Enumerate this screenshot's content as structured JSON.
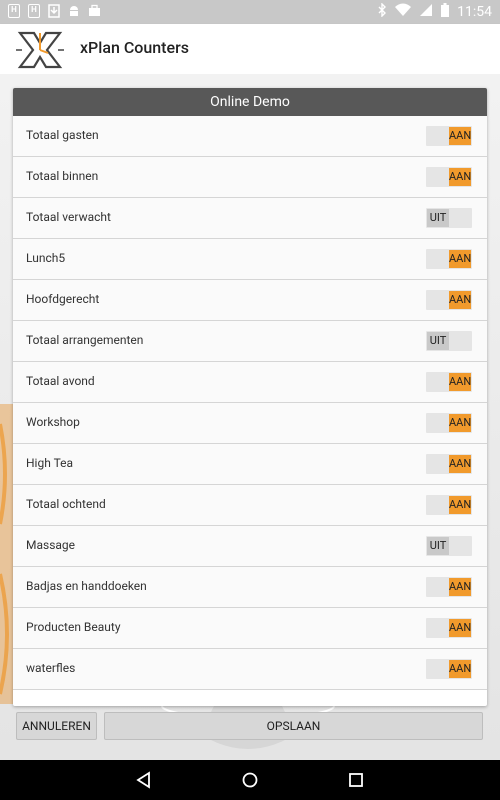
{
  "status_bar": {
    "left_icons": [
      "sdcard-icon",
      "sdcard-icon",
      "download-icon",
      "android-icon",
      "briefcase-icon"
    ],
    "right_icons": [
      "bluetooth-icon",
      "wifi-icon",
      "signal-icon",
      "battery-icon"
    ],
    "time": "11:54"
  },
  "app_bar": {
    "title": "xPlan Counters",
    "logo_icon": "xplan-logo-icon"
  },
  "dialog": {
    "title": "Online Demo",
    "rows": [
      {
        "label": "Totaal gasten",
        "state": "AAN"
      },
      {
        "label": "Totaal binnen",
        "state": "AAN"
      },
      {
        "label": "Totaal verwacht",
        "state": "UIT"
      },
      {
        "label": "Lunch5",
        "state": "AAN"
      },
      {
        "label": "Hoofdgerecht",
        "state": "AAN"
      },
      {
        "label": "Totaal arrangementen",
        "state": "UIT"
      },
      {
        "label": "Totaal avond",
        "state": "AAN"
      },
      {
        "label": "Workshop",
        "state": "AAN"
      },
      {
        "label": "High Tea",
        "state": "AAN"
      },
      {
        "label": "Totaal ochtend",
        "state": "AAN"
      },
      {
        "label": "Massage",
        "state": "UIT"
      },
      {
        "label": "Badjas en handdoeken",
        "state": "AAN"
      },
      {
        "label": "Producten Beauty",
        "state": "AAN"
      },
      {
        "label": "waterfles",
        "state": "AAN"
      }
    ]
  },
  "buttons": {
    "cancel_label": "ANNULEREN",
    "save_label": "OPSLAAN"
  },
  "colors": {
    "accent": "#f19a2c",
    "header": "#585858"
  }
}
